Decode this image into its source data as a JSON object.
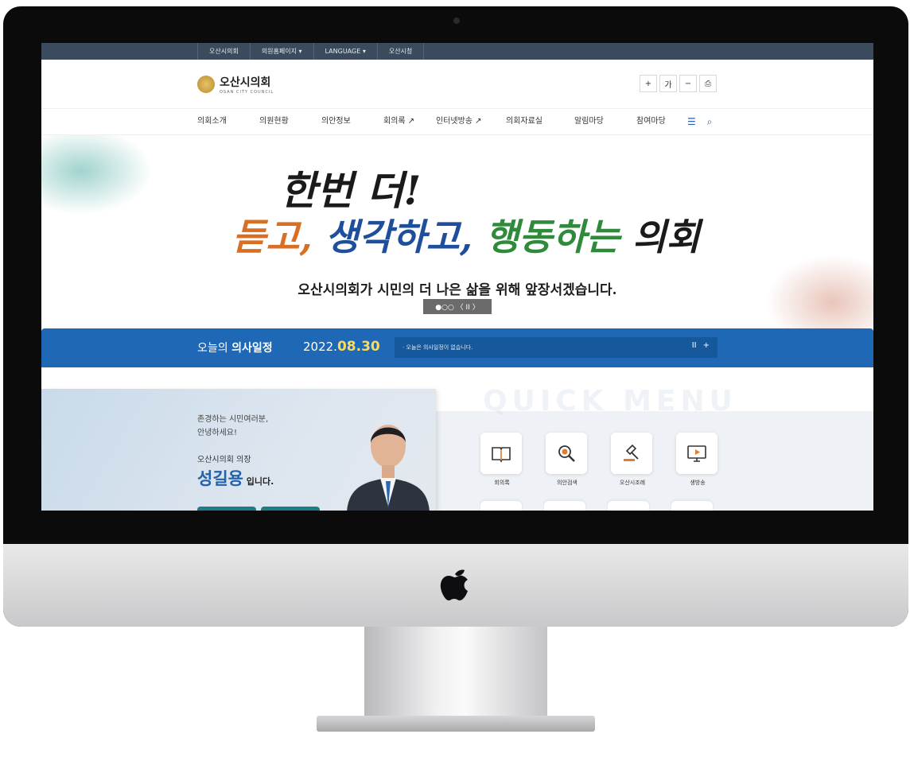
{
  "topbar": {
    "items": [
      "오산시의회",
      "의원홈페이지 ▾",
      "LANGUAGE ▾",
      "오산시청"
    ]
  },
  "header": {
    "logo_name": "오산시의회",
    "logo_sub": "OSAN CITY COUNCIL",
    "tools": [
      "+",
      "가",
      "−",
      "⎙"
    ]
  },
  "nav": {
    "items": [
      "의회소개",
      "의원현황",
      "의안정보",
      "회의록 ↗",
      "인터넷방송 ↗",
      "의회자료실",
      "알림마당",
      "참여마당"
    ]
  },
  "hero": {
    "line1": "한번 더!",
    "line2_a": "듣고,",
    "line2_b": "생각하고,",
    "line2_c": "행동하는",
    "line2_d": "의회",
    "subline": "오산시의회가 시민의 더 나은 삶을 위해 앞장서겠습니다.",
    "pager": "●○○ 〈 II 〉"
  },
  "schedule": {
    "label_a": "오늘의 ",
    "label_b": "의사일정",
    "date_a": "2022.",
    "date_b": "08.30",
    "message": "· 오늘은 의사일정이 없습니다.",
    "ctl_pause": "II",
    "ctl_more": "+"
  },
  "speaker": {
    "greeting1": "존경하는 시민여러분,",
    "greeting2": "안녕하세요!",
    "title": "오산시의회 의장",
    "name": "성길용",
    "suffix": " 입니다."
  },
  "quick": {
    "bg_text": "QUICK MENU",
    "items": [
      {
        "label": "회의록",
        "icon": "book-icon"
      },
      {
        "label": "의안검색",
        "icon": "magnifier-icon"
      },
      {
        "label": "오산시조례",
        "icon": "gavel-icon"
      },
      {
        "label": "생방송",
        "icon": "monitor-play-icon"
      }
    ]
  },
  "colors": {
    "topbar": "#3c4a5e",
    "schedule_bar": "#1e68b5",
    "accent_blue": "#2361ab",
    "orange": "#d86f22",
    "green": "#2f8a3c"
  }
}
